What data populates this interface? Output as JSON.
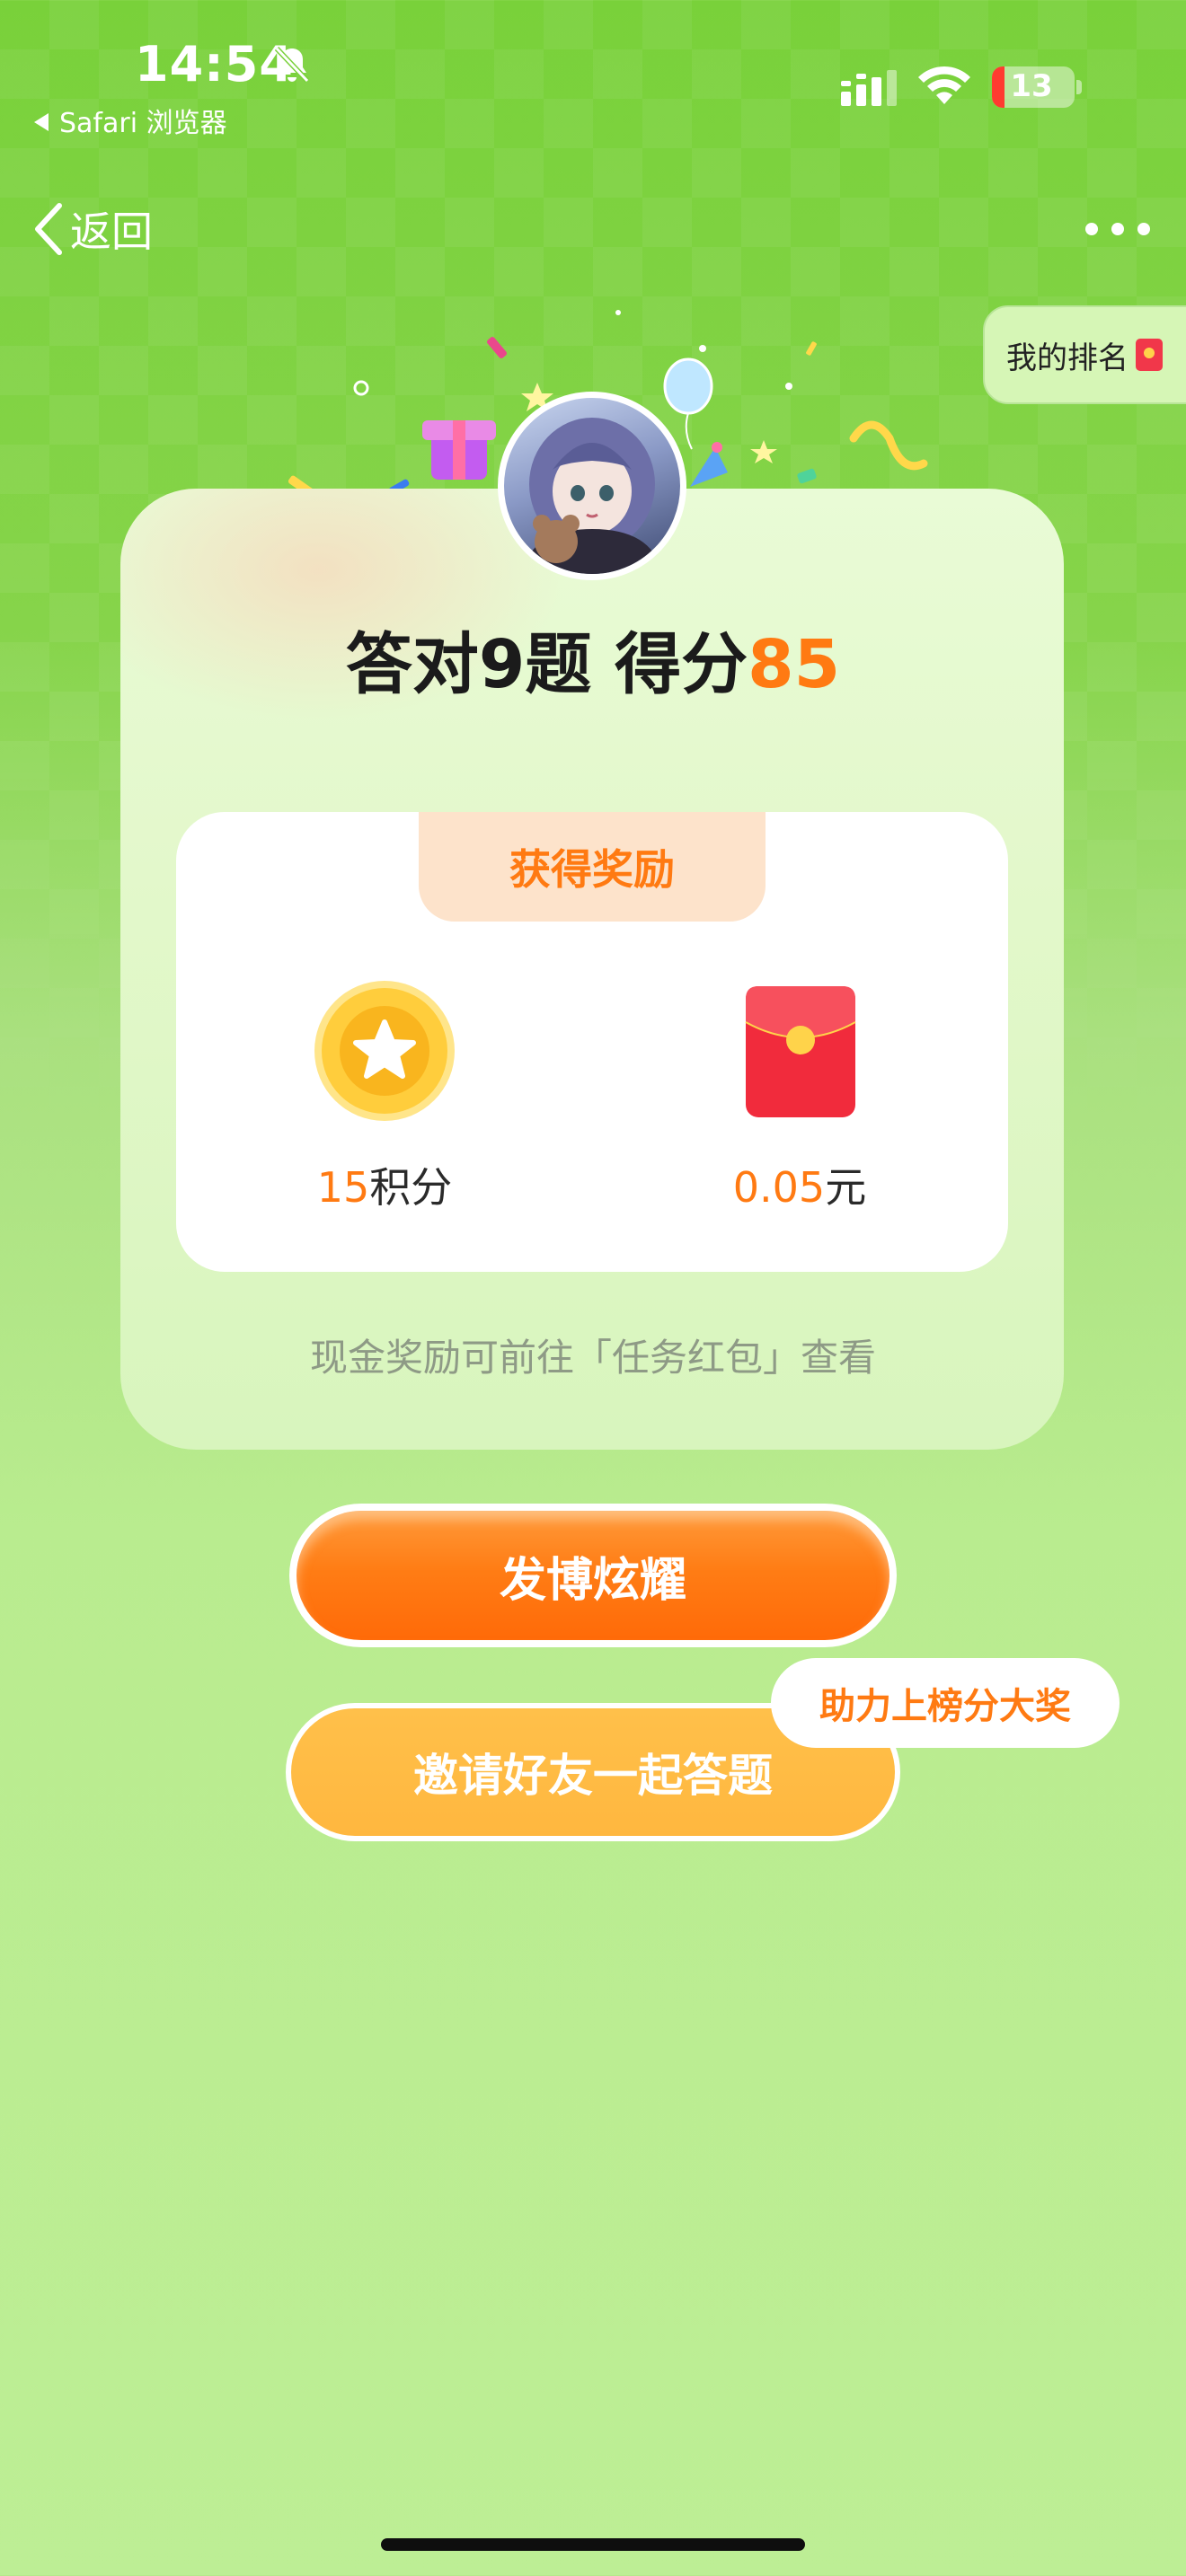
{
  "status_bar": {
    "time": "14:54",
    "back_app": "Safari 浏览器",
    "battery_level": "13"
  },
  "nav": {
    "back_label": "返回",
    "rank_label": "我的排名"
  },
  "result": {
    "prefix": "答对9题 得分",
    "score": "85"
  },
  "rewards": {
    "title": "获得奖励",
    "points_value": "15",
    "points_unit": "积分",
    "cash_value": "0.05",
    "cash_unit": "元",
    "tip": "现金奖励可前往「任务红包」查看"
  },
  "actions": {
    "brag_label": "发博炫耀",
    "invite_label": "邀请好友一起答题",
    "invite_badge": "助力上榜分大奖"
  },
  "colors": {
    "accent": "#ff7a12",
    "background_green": "#79d13a",
    "card_bg": "#e3f8cb"
  }
}
